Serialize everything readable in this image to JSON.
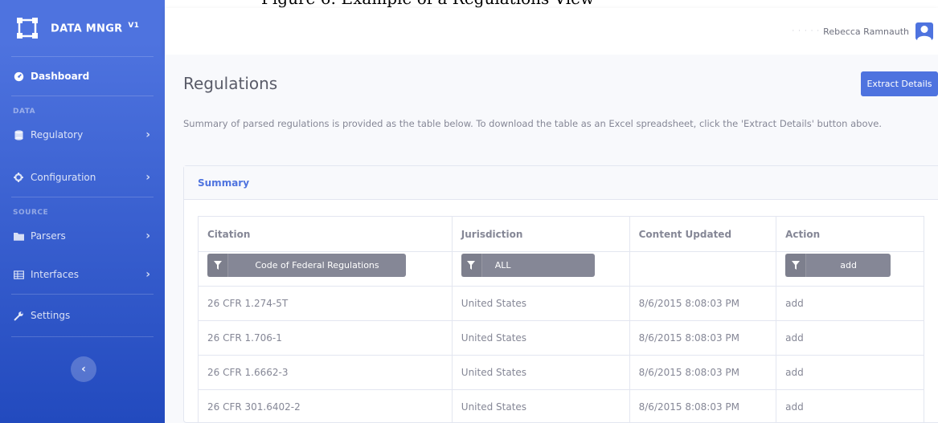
{
  "caption": "Figure 6: Example of a Regulations View",
  "sidebar": {
    "brand": {
      "name": "DATA MNGR",
      "version": "V1"
    },
    "dashboard": "Dashboard",
    "section_data": "DATA",
    "regulatory": "Regulatory",
    "configuration": "Configuration",
    "section_source": "SOURCE",
    "parsers": "Parsers",
    "interfaces": "Interfaces",
    "settings": "Settings"
  },
  "topbar": {
    "user_name": "Rebecca Ramnauth"
  },
  "page": {
    "title": "Regulations",
    "extract_button": "Extract Details",
    "description": "Summary of parsed regulations is provided as the table below. To download the table as an Excel spreadsheet, click the 'Extract Details' button above."
  },
  "summary_card": {
    "header": "Summary",
    "columns": [
      "Citation",
      "Jurisdiction",
      "Content Updated",
      "Action"
    ],
    "filters": {
      "citation": "Code of Federal Regulations",
      "jurisdiction": "ALL",
      "action": "add"
    },
    "rows": [
      {
        "citation": "26 CFR 1.274-5T",
        "jurisdiction": "United States",
        "updated": "8/6/2015 8:08:03 PM",
        "action": "add"
      },
      {
        "citation": "26 CFR 1.706-1",
        "jurisdiction": "United States",
        "updated": "8/6/2015 8:08:03 PM",
        "action": "add"
      },
      {
        "citation": "26 CFR 1.6662-3",
        "jurisdiction": "United States",
        "updated": "8/6/2015 8:08:03 PM",
        "action": "add"
      },
      {
        "citation": "26 CFR 301.6402-2",
        "jurisdiction": "United States",
        "updated": "8/6/2015 8:08:03 PM",
        "action": "add"
      }
    ]
  },
  "colors": {
    "primary": "#4e73df",
    "primary_dark": "#224abe",
    "muted": "#858796",
    "border": "#e3e6f0"
  }
}
